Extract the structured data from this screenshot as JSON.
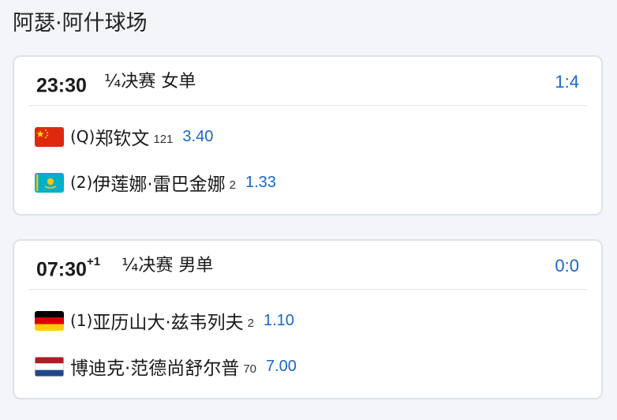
{
  "venue": {
    "title": "阿瑟·阿什球场"
  },
  "matches": [
    {
      "time": "23:30",
      "day_offset": "",
      "round": "¼决赛 女单",
      "ratio": "1:4",
      "players": [
        {
          "flag": "china-flag-icon",
          "seed": "(Q)",
          "name": "郑钦文",
          "rank": "121",
          "odds": "3.40"
        },
        {
          "flag": "kazakhstan-flag-icon",
          "seed": "(2)",
          "name": "伊莲娜·雷巴金娜",
          "rank": "2",
          "odds": "1.33"
        }
      ]
    },
    {
      "time": "07:30",
      "day_offset": "+1",
      "round": "¼决赛 男单",
      "ratio": "0:0",
      "players": [
        {
          "flag": "germany-flag-icon",
          "seed": "(1)",
          "name": "亚历山大·兹韦列夫",
          "rank": "2",
          "odds": "1.10"
        },
        {
          "flag": "netherlands-flag-icon",
          "seed": "",
          "name": "博迪克·范德尚舒尔普",
          "rank": "70",
          "odds": "7.00"
        }
      ]
    }
  ],
  "colors": {
    "accent": "#1768c9",
    "background": "#f4f5f9",
    "card_border": "#dde1ea"
  }
}
